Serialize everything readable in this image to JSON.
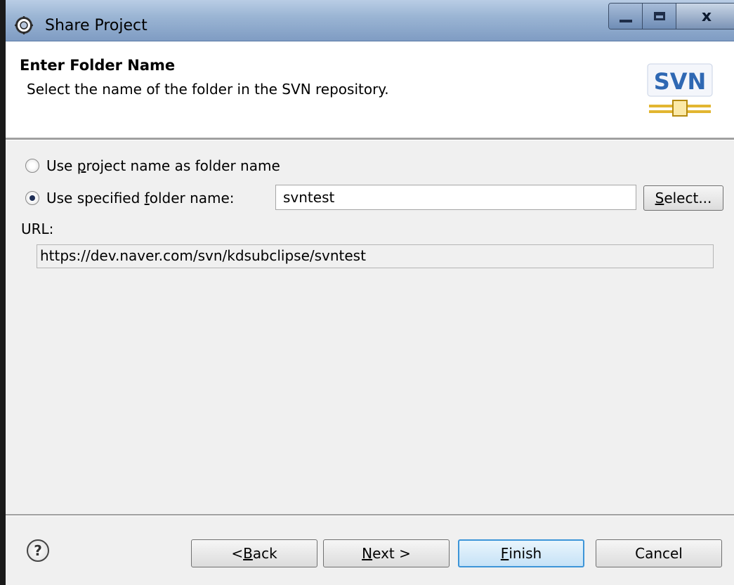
{
  "window": {
    "title": "Share Project",
    "close_glyph": "x"
  },
  "header": {
    "title": "Enter Folder Name",
    "description": "Select the name of the folder in the SVN repository.",
    "logo_text": "SVN"
  },
  "options": {
    "project_name": {
      "pre": "Use ",
      "accel": "p",
      "post": "roject name as folder name",
      "checked": false
    },
    "specified_name": {
      "pre": "Use specified ",
      "accel": "f",
      "post": "older name:",
      "checked": true
    }
  },
  "folder_input": {
    "value": "svntest"
  },
  "select_button": {
    "accel": "S",
    "rest": "elect..."
  },
  "url": {
    "label": "URL:",
    "value": "https://dev.naver.com/svn/kdsubclipse/svntest"
  },
  "footer": {
    "help_glyph": "?",
    "back": {
      "pre": "< ",
      "accel": "B",
      "post": "ack"
    },
    "next": {
      "accel": "N",
      "post": "ext >"
    },
    "finish": {
      "accel": "F",
      "post": "inish"
    },
    "cancel": "Cancel"
  },
  "icons": {
    "app": "eclipse-gear-icon",
    "logo": "svn-logo-icon",
    "help": "help-icon",
    "minimize": "minimize-icon",
    "maximize": "maximize-icon",
    "close": "close-icon"
  },
  "colors": {
    "titlebar": "#9bb5d4",
    "primary_border": "#3d95d8",
    "svn_blue": "#2f68b3",
    "svn_gold": "#e2b631"
  }
}
